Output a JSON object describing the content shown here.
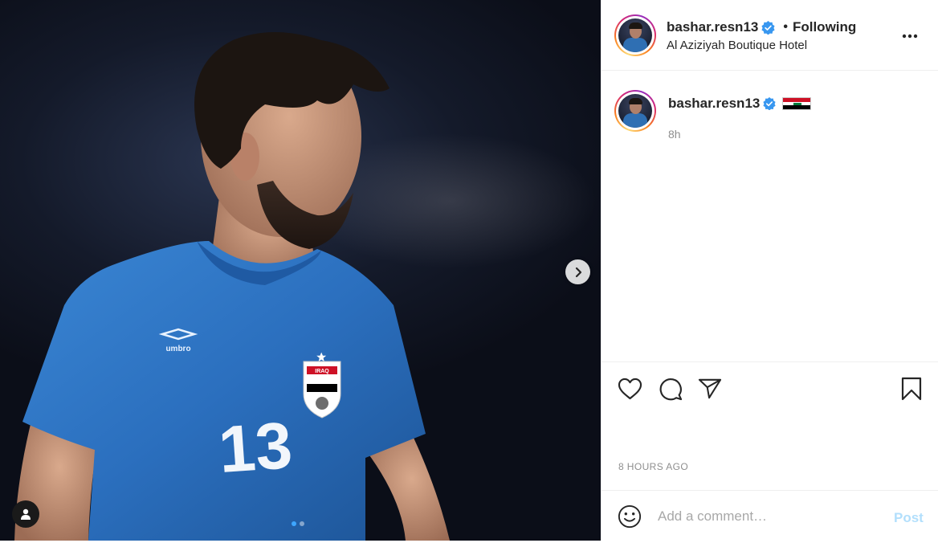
{
  "post": {
    "username": "bashar.resn13",
    "follow_status": "Following",
    "separator": "•",
    "location": "Al Aziziyah Boutique Hotel",
    "caption_flag": "iraq-flag",
    "caption_time": "8h",
    "timestamp": "8 HOURS AGO",
    "carousel": {
      "count": 2,
      "active": 1
    }
  },
  "photo": {
    "jersey_number": "13",
    "jersey_brand": "umbro",
    "crest_text": "IRAQ",
    "subject": "football player in blue jersey"
  },
  "comment": {
    "placeholder": "Add a comment…",
    "post_label": "Post"
  },
  "icons": {
    "more": "more-horizontal-icon",
    "like": "heart-icon",
    "comment": "comment-bubble-icon",
    "share": "paper-plane-icon",
    "save": "bookmark-icon",
    "emoji": "smiley-icon",
    "next": "chevron-right-icon",
    "tags": "user-tag-icon",
    "verified": "verified-badge-icon"
  },
  "colors": {
    "verified": "#3897f0",
    "post_button_disabled": "#b2dffc",
    "muted_text": "#8e8e8e",
    "jersey_blue": "#2e74c4",
    "active_dot": "#3ea6ff"
  }
}
